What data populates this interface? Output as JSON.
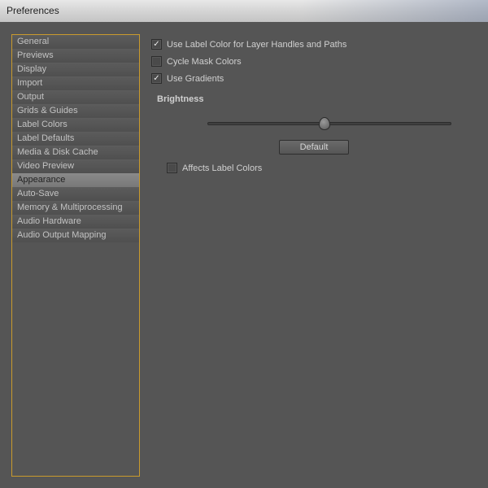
{
  "window": {
    "title": "Preferences"
  },
  "sidebar": {
    "items": [
      {
        "label": "General"
      },
      {
        "label": "Previews"
      },
      {
        "label": "Display"
      },
      {
        "label": "Import"
      },
      {
        "label": "Output"
      },
      {
        "label": "Grids & Guides"
      },
      {
        "label": "Label Colors"
      },
      {
        "label": "Label Defaults"
      },
      {
        "label": "Media & Disk Cache"
      },
      {
        "label": "Video Preview"
      },
      {
        "label": "Appearance"
      },
      {
        "label": "Auto-Save"
      },
      {
        "label": "Memory & Multiprocessing"
      },
      {
        "label": "Audio Hardware"
      },
      {
        "label": "Audio Output Mapping"
      }
    ],
    "selected_index": 10
  },
  "content": {
    "use_label_color": {
      "label": "Use Label Color for Layer Handles and Paths",
      "checked": true
    },
    "cycle_mask_colors": {
      "label": "Cycle Mask Colors",
      "checked": false
    },
    "use_gradients": {
      "label": "Use Gradients",
      "checked": true
    },
    "brightness": {
      "group_label": "Brightness",
      "default_button": "Default",
      "affects_label_colors": {
        "label": "Affects Label Colors",
        "checked": false
      }
    }
  }
}
